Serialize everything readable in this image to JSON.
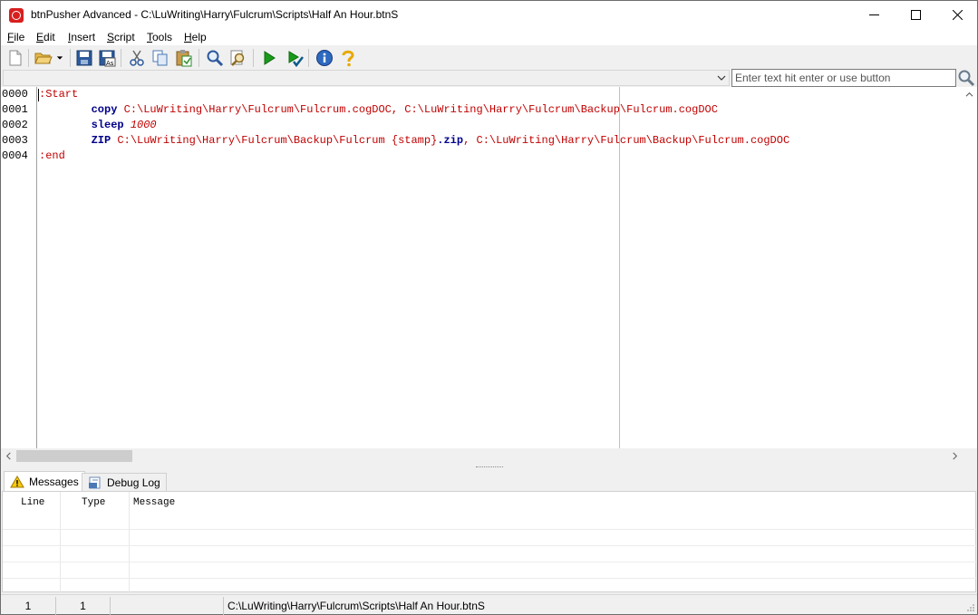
{
  "window": {
    "title": "btnPusher Advanced - C:\\LuWriting\\Harry\\Fulcrum\\Scripts\\Half An Hour.btnS"
  },
  "menu": [
    {
      "label": "File",
      "key": "F",
      "rest": "ile"
    },
    {
      "label": "Edit",
      "key": "E",
      "rest": "dit"
    },
    {
      "label": "Insert",
      "key": "I",
      "rest": "nsert"
    },
    {
      "label": "Script",
      "key": "S",
      "rest": "cript"
    },
    {
      "label": "Tools",
      "key": "T",
      "rest": "ools"
    },
    {
      "label": "Help",
      "key": "H",
      "rest": "elp"
    }
  ],
  "toolbar_icons": [
    "new-file-icon",
    "open-folder-icon",
    "save-icon",
    "save-as-icon",
    "cut-icon",
    "copy-icon",
    "paste-icon",
    "find-icon",
    "replace-icon",
    "run-icon",
    "run-check-icon",
    "info-icon",
    "help-icon"
  ],
  "search": {
    "placeholder": "Enter text hit enter or use button"
  },
  "editor": {
    "line_numbers": [
      "0000",
      "0001",
      "0002",
      "0003",
      "0004"
    ],
    "lines": [
      {
        "label": ":Start"
      },
      {
        "indent": "        ",
        "keyword": "copy",
        "args": " C:\\LuWriting\\Harry\\Fulcrum\\Fulcrum.cogDOC, C:\\LuWriting\\Harry\\Fulcrum\\Backup\\Fulcrum.cogDOC"
      },
      {
        "indent": "        ",
        "keyword": "sleep",
        "num": " 1000"
      },
      {
        "indent": "        ",
        "keyword": "ZIP",
        "args1": " C:\\LuWriting\\Harry\\Fulcrum\\Backup\\Fulcrum {stamp}",
        "ext": ".zip",
        "args2": ", C:\\LuWriting\\Harry\\Fulcrum\\Backup\\Fulcrum.cogDOC"
      },
      {
        "label": ":end"
      }
    ]
  },
  "tabs": [
    {
      "label": "Messages",
      "icon": "warning-icon",
      "active": true
    },
    {
      "label": "Debug Log",
      "icon": "debug-log-icon",
      "active": false
    }
  ],
  "messages": {
    "columns": [
      "Line",
      "Type",
      "Message"
    ],
    "rows": []
  },
  "status": {
    "line": "1",
    "col": "1",
    "empty": "",
    "path": "C:\\LuWriting\\Harry\\Fulcrum\\Scripts\\Half An Hour.btnS"
  },
  "colors": {
    "keyword": "#00008b",
    "string": "#c00000",
    "run_green": "#1a9a1a"
  }
}
